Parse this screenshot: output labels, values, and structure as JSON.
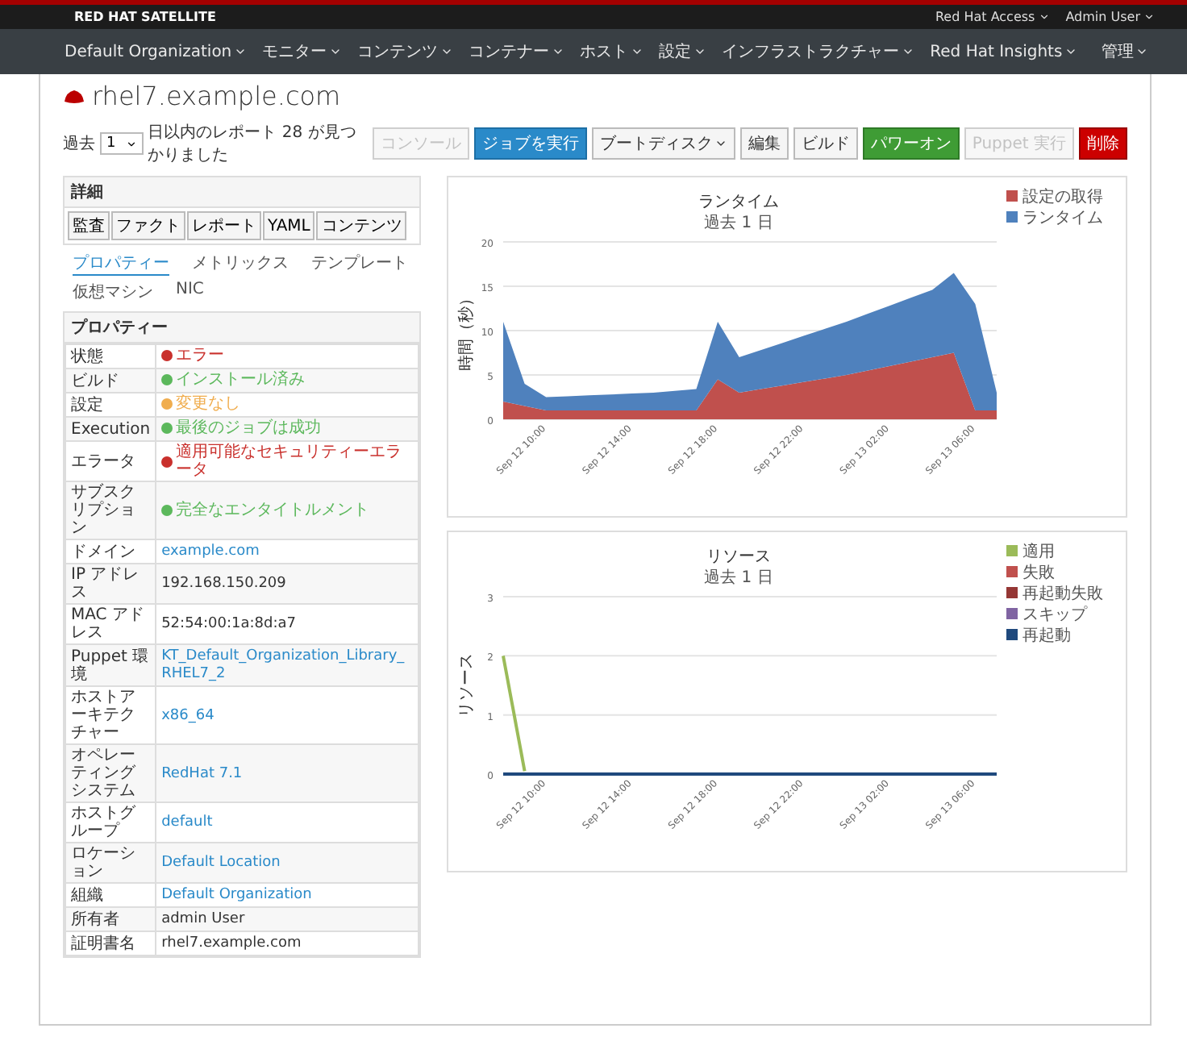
{
  "brand": "RED HAT SATELLITE",
  "top_links": [
    "Red Hat Access",
    "Admin User"
  ],
  "nav": [
    "Default Organization",
    "モニター",
    "コンテンツ",
    "コンテナー",
    "ホスト",
    "設定",
    "インフラストラクチャー",
    "Red Hat Insights",
    "管理"
  ],
  "host": {
    "title": "rhel7.example.com"
  },
  "report_filter": {
    "prefix": "過去",
    "value": "1",
    "suffix": "日以内のレポート 28 が見つかりました"
  },
  "actions": [
    {
      "label": "コンソール",
      "kind": "plain",
      "disabled": true,
      "dropdown": false
    },
    {
      "label": "ジョブを実行",
      "kind": "primary",
      "disabled": false,
      "dropdown": false
    },
    {
      "label": "ブートディスク",
      "kind": "plain",
      "disabled": false,
      "dropdown": true
    },
    {
      "label": "編集",
      "kind": "plain",
      "disabled": false,
      "dropdown": false
    },
    {
      "label": "ビルド",
      "kind": "plain",
      "disabled": false,
      "dropdown": false
    },
    {
      "label": "パワーオン",
      "kind": "success",
      "disabled": false,
      "dropdown": false
    },
    {
      "label": "Puppet 実行",
      "kind": "plain",
      "disabled": true,
      "dropdown": false
    },
    {
      "label": "削除",
      "kind": "danger",
      "disabled": false,
      "dropdown": false
    }
  ],
  "details": {
    "title": "詳細",
    "tabs": [
      "監査",
      "ファクト",
      "レポート",
      "YAML",
      "コンテンツ"
    ]
  },
  "subtabs": [
    {
      "label": "プロパティー",
      "selected": true
    },
    {
      "label": "メトリックス",
      "selected": false
    },
    {
      "label": "テンプレート",
      "selected": false
    },
    {
      "label": "仮想マシン",
      "selected": false
    },
    {
      "label": "NIC",
      "selected": false
    }
  ],
  "properties": {
    "title": "プロパティー",
    "rows": [
      {
        "label": "状態",
        "value": "エラー",
        "kind": "status",
        "color": "#c9302c"
      },
      {
        "label": "ビルド",
        "value": "インストール済み",
        "kind": "status",
        "color": "#5cb85c"
      },
      {
        "label": "設定",
        "value": "変更なし",
        "kind": "status",
        "color": "#f0ad4e"
      },
      {
        "label": "Execution",
        "value": "最後のジョブは成功",
        "kind": "status",
        "color": "#5cb85c"
      },
      {
        "label": "エラータ",
        "value": "適用可能なセキュリティーエラータ",
        "kind": "status",
        "color": "#c9302c"
      },
      {
        "label": "サブスクリプション",
        "value": "完全なエンタイトルメント",
        "kind": "status",
        "color": "#5cb85c"
      },
      {
        "label": "ドメイン",
        "value": "example.com",
        "kind": "link"
      },
      {
        "label": "IP アドレス",
        "value": "192.168.150.209",
        "kind": "text"
      },
      {
        "label": "MAC アドレス",
        "value": "52:54:00:1a:8d:a7",
        "kind": "text"
      },
      {
        "label": "Puppet 環境",
        "value": "KT_Default_Organization_Library_RHEL7_2",
        "kind": "link"
      },
      {
        "label": "ホストアーキテクチャー",
        "value": "x86_64",
        "kind": "link"
      },
      {
        "label": "オペレーティングシステム",
        "value": "RedHat 7.1",
        "kind": "link"
      },
      {
        "label": "ホストグループ",
        "value": "default",
        "kind": "link"
      },
      {
        "label": "ロケーション",
        "value": "Default Location",
        "kind": "link"
      },
      {
        "label": "組織",
        "value": "Default Organization",
        "kind": "link"
      },
      {
        "label": "所有者",
        "value": "admin User",
        "kind": "text"
      },
      {
        "label": "証明書名",
        "value": "rhel7.example.com",
        "kind": "text"
      }
    ]
  },
  "charts": [
    {
      "chart_data": {
        "type": "area",
        "stacked": true,
        "title": "ランタイム",
        "subtitle": "過去 1 日",
        "ylabel": "時間（秒）",
        "grid": true,
        "legend": true,
        "ylim": [
          0,
          20
        ],
        "yticks": [
          0,
          5,
          10,
          15,
          20
        ],
        "categories": [
          null,
          null,
          "Sep 12 10:00",
          null,
          null,
          null,
          "Sep 12 14:00",
          null,
          null,
          null,
          "Sep 12 18:00",
          null,
          null,
          null,
          "Sep 12 22:00",
          null,
          null,
          null,
          "Sep 13 02:00",
          null,
          null,
          null,
          "Sep 13 06:00",
          null
        ],
        "series": [
          {
            "name": "設定の取得",
            "color": "#c0504d",
            "values": [
              2,
              1.5,
              1,
              1,
              1,
              1,
              1,
              1,
              1,
              1,
              4.5,
              3,
              3.4,
              3.8,
              4.2,
              4.6,
              5,
              5.5,
              6,
              6.5,
              7,
              7.5,
              1,
              1
            ]
          },
          {
            "name": "ランタイム",
            "color": "#4f81bd",
            "values": [
              9,
              2.5,
              1.5,
              1.6,
              1.7,
              1.8,
              1.9,
              2,
              2.2,
              2.4,
              6.5,
              4,
              4.4,
              4.8,
              5.2,
              5.6,
              6,
              6.4,
              6.8,
              7.2,
              7.6,
              9,
              12,
              2
            ]
          }
        ]
      }
    },
    {
      "chart_data": {
        "type": "line",
        "title": "リソース",
        "subtitle": "過去 1 日",
        "ylabel": "リソース",
        "grid": true,
        "legend": true,
        "ylim": [
          0,
          3
        ],
        "yticks": [
          0,
          1,
          2,
          3
        ],
        "categories": [
          null,
          null,
          "Sep 12 10:00",
          null,
          null,
          null,
          "Sep 12 14:00",
          null,
          null,
          null,
          "Sep 12 18:00",
          null,
          null,
          null,
          "Sep 12 22:00",
          null,
          null,
          null,
          "Sep 13 02:00",
          null,
          null,
          null,
          "Sep 13 06:00",
          null
        ],
        "series": [
          {
            "name": "適用",
            "color": "#9bbb59",
            "values": [
              2,
              0.05,
              null,
              null,
              null,
              null,
              null,
              null,
              null,
              null,
              null,
              null,
              null,
              null,
              null,
              null,
              null,
              null,
              null,
              null,
              null,
              null,
              null,
              null
            ]
          },
          {
            "name": "失敗",
            "color": "#c0504d",
            "values": [
              null,
              null,
              null,
              null,
              null,
              null,
              null,
              null,
              null,
              null,
              null,
              null,
              null,
              null,
              null,
              null,
              null,
              null,
              null,
              null,
              null,
              null,
              null,
              null
            ]
          },
          {
            "name": "再起動失敗",
            "color": "#953735",
            "values": [
              null,
              null,
              null,
              null,
              null,
              null,
              null,
              null,
              null,
              null,
              null,
              null,
              null,
              null,
              null,
              null,
              null,
              null,
              null,
              null,
              null,
              null,
              null,
              null
            ]
          },
          {
            "name": "スキップ",
            "color": "#8064a2",
            "values": [
              null,
              null,
              null,
              null,
              null,
              null,
              null,
              null,
              null,
              null,
              null,
              null,
              null,
              null,
              null,
              null,
              null,
              null,
              null,
              null,
              null,
              null,
              null,
              null
            ]
          },
          {
            "name": "再起動",
            "color": "#1f497d",
            "values": [
              0,
              0,
              0,
              0,
              0,
              0,
              0,
              0,
              0,
              0,
              0,
              0,
              0,
              0,
              0,
              0,
              0,
              0,
              0,
              0,
              0,
              0,
              0,
              0
            ]
          }
        ]
      }
    }
  ]
}
